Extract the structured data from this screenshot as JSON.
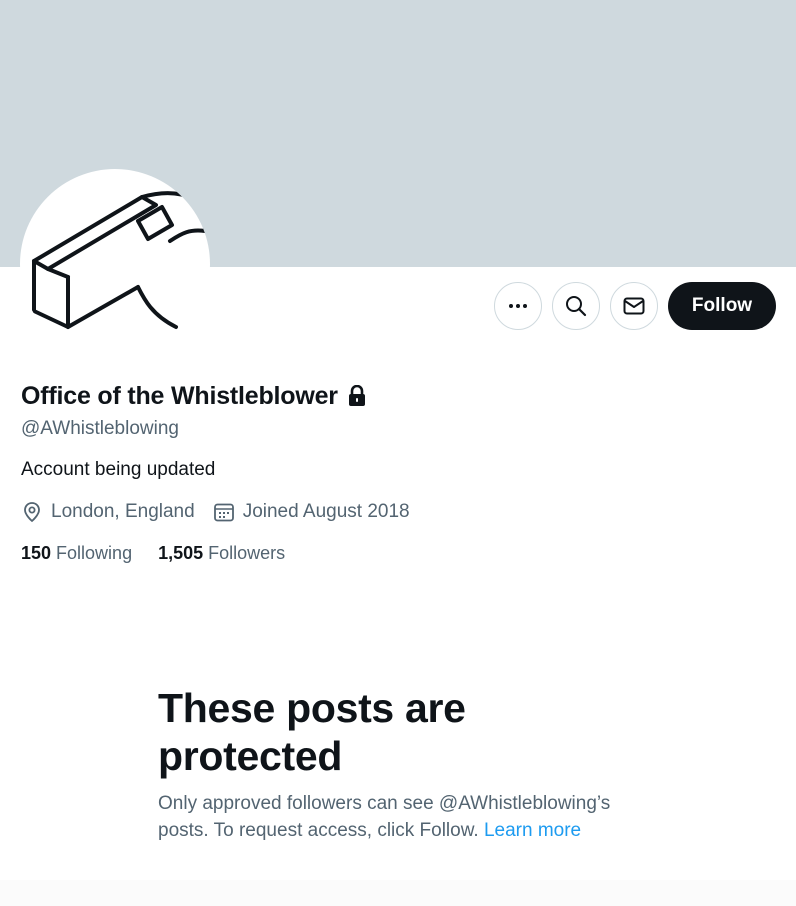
{
  "profile": {
    "display_name": "Office of the Whistleblower",
    "handle": "@AWhistleblowing",
    "bio": "Account being updated",
    "location": "London, England",
    "joined": "Joined August 2018",
    "following_count": "150",
    "following_label": "Following",
    "followers_count": "1,505",
    "followers_label": "Followers"
  },
  "actions": {
    "more_icon": "more-icon",
    "search_icon": "search-icon",
    "message_icon": "mail-icon",
    "follow_label": "Follow"
  },
  "protected": {
    "title_line1": "These posts are",
    "title_line2": "protected",
    "body": "Only approved followers can see @AWhistleblowing’s posts. To request access, click Follow.",
    "learn_more": "Learn more"
  },
  "colors": {
    "banner": "#cfd9de",
    "primary_text": "#0f1419",
    "secondary_text": "#536471",
    "link": "#1d9bf0",
    "follow_button": "#0f1419"
  }
}
